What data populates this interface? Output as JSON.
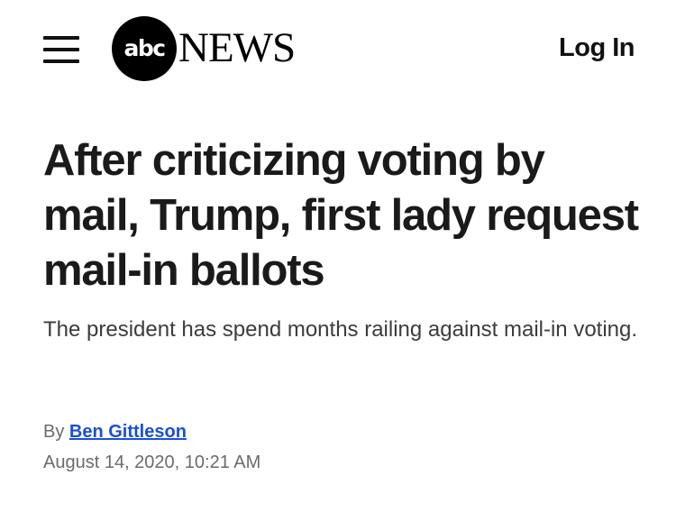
{
  "header": {
    "logo_mark": "abc",
    "logo_wordmark": "NEWS",
    "login_label": "Log In",
    "menu_icon": "hamburger-menu-icon"
  },
  "article": {
    "headline": "After criticizing voting by mail, Trump, first lady request mail-in ballots",
    "subheadline": "The president has spend months railing against mail-in voting.",
    "byline_prefix": "By",
    "author": "Ben Gittleson",
    "timestamp": "August 14, 2020, 10:21 AM"
  },
  "colors": {
    "author_link": "#1a4fd6",
    "text": "#1a1a1a",
    "muted": "#6b6b6b"
  }
}
